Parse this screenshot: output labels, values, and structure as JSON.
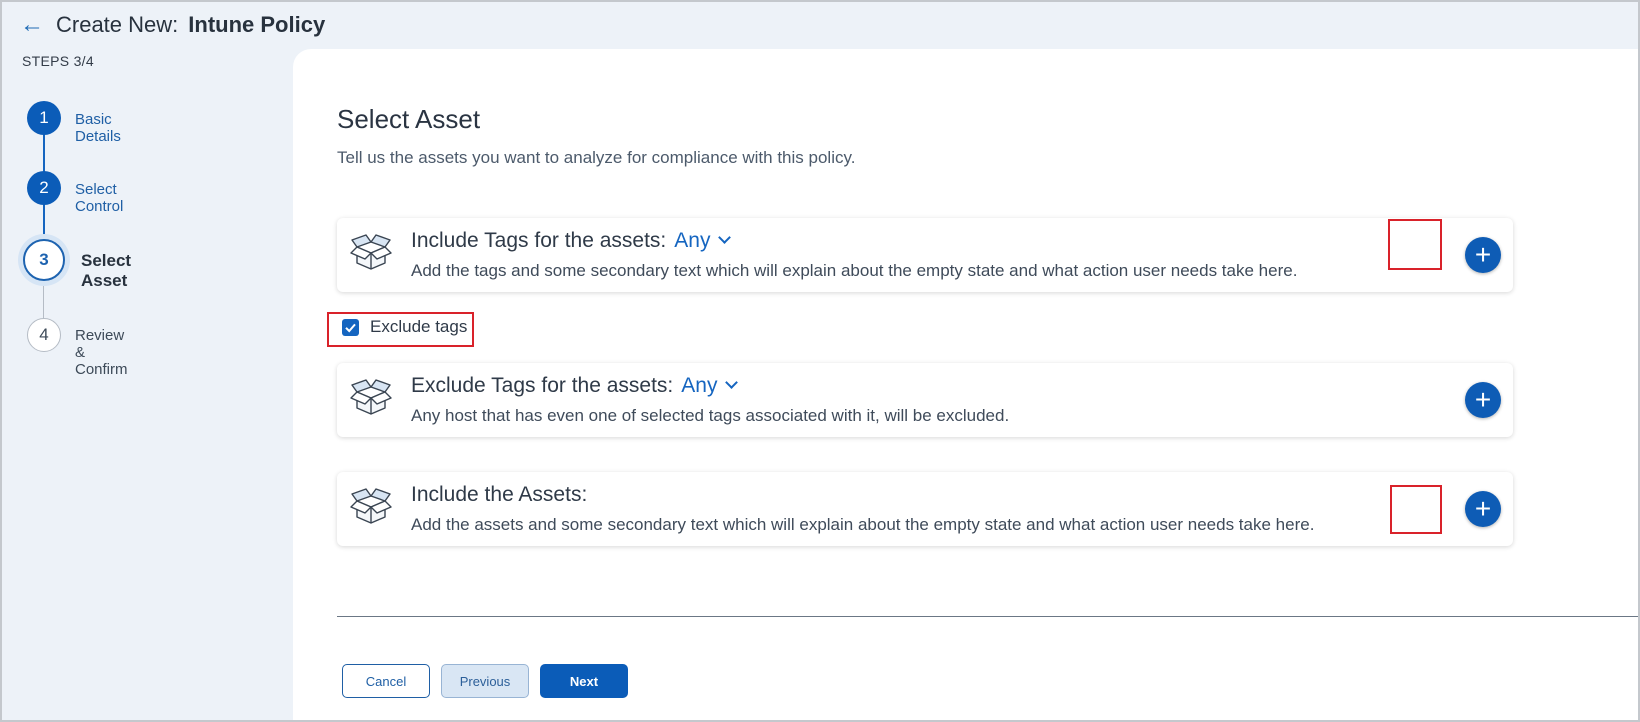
{
  "header": {
    "back_label": "←",
    "title_prefix": "Create New:",
    "title_main": "Intune Policy"
  },
  "steps_label": "STEPS 3/4",
  "steps": [
    {
      "number": "1",
      "label": "Basic Details",
      "state": "done"
    },
    {
      "number": "2",
      "label": "Select Control",
      "state": "done"
    },
    {
      "number": "3",
      "label": "Select Asset",
      "state": "current"
    },
    {
      "number": "4",
      "label": "Review & Confirm",
      "state": "todo"
    }
  ],
  "main": {
    "title": "Select Asset",
    "subtitle": "Tell us the assets you want to analyze for compliance with this policy.",
    "include_tags": {
      "title": "Include Tags for the assets:",
      "any_label": "Any",
      "description": "Add the tags and some secondary text which will explain about the empty state and what action user needs take here."
    },
    "exclude_checkbox": {
      "label": "Exclude tags",
      "checked": true
    },
    "exclude_tags": {
      "title": "Exclude Tags for the assets:",
      "any_label": "Any",
      "description": "Any host that has even one of selected tags associated with it, will be excluded."
    },
    "include_assets": {
      "title": "Include the Assets:",
      "description": "Add the assets and some secondary text which will explain about the empty state and what action user needs take here."
    },
    "add_symbol": "+"
  },
  "footer": {
    "cancel_label": "Cancel",
    "previous_label": "Previous",
    "next_label": "Next"
  },
  "colors": {
    "accent": "#0b5cb8",
    "highlight": "#d9222a",
    "background": "#edf2f8"
  }
}
